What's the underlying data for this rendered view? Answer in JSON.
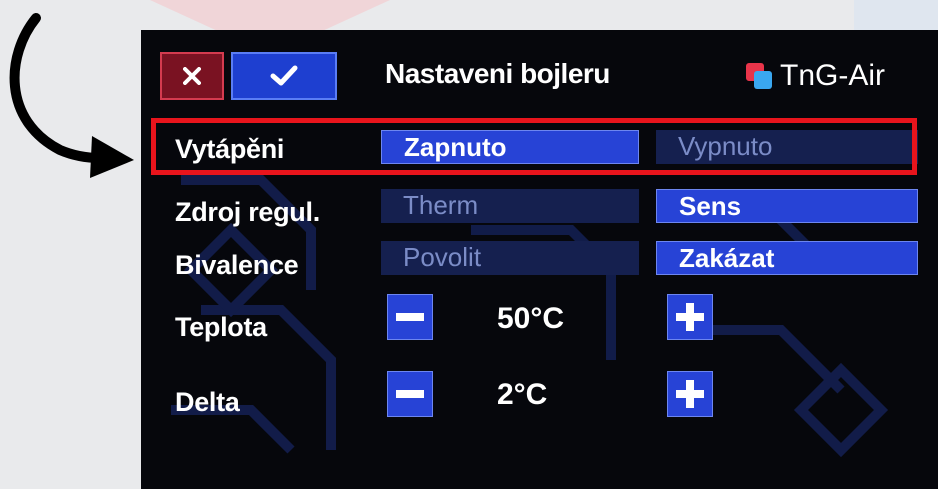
{
  "header": {
    "cancel_icon": "close-icon",
    "confirm_icon": "check-icon",
    "title": "Nastaveni bojleru",
    "brand": "TnG-Air"
  },
  "rows": {
    "vytapeni": {
      "label": "Vytápěni",
      "options": [
        "Zapnuto",
        "Vypnuto"
      ],
      "selected": "Zapnuto"
    },
    "zdroj": {
      "label": "Zdroj regul.",
      "options": [
        "Therm",
        "Sens"
      ],
      "selected": "Sens"
    },
    "bivalence": {
      "label": "Bivalence",
      "options": [
        "Povolit",
        "Zakázat"
      ],
      "selected": "Zakázat"
    },
    "teplota": {
      "label": "Teplota",
      "value": "50°C"
    },
    "delta": {
      "label": "Delta",
      "value": "2°C"
    }
  },
  "colors": {
    "accent_blue": "#2743d6",
    "highlight_red": "#e8141c",
    "cancel_red": "#7a1222"
  }
}
